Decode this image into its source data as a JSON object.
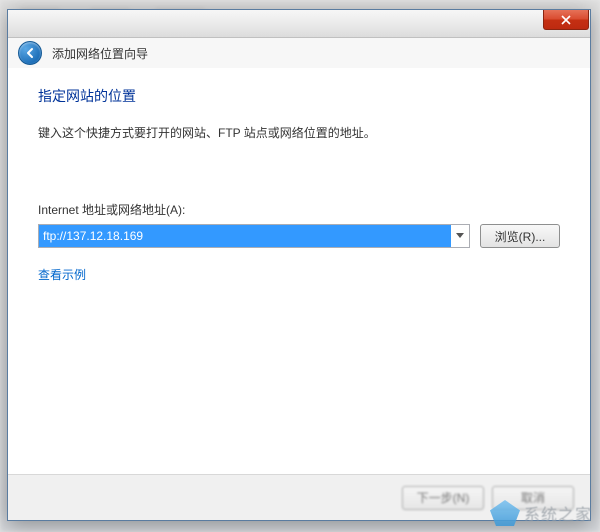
{
  "wizard": {
    "title": "添加网络位置向导"
  },
  "page": {
    "heading": "指定网站的位置",
    "description": "键入这个快捷方式要打开的网站、FTP 站点或网络位置的地址。"
  },
  "field": {
    "label": "Internet 地址或网络地址(A):",
    "value": "ftp://137.12.18.169",
    "browse": "浏览(R)..."
  },
  "links": {
    "example": "查看示例"
  },
  "footer": {
    "next": "下一步(N)",
    "cancel": "取消"
  },
  "watermark": {
    "text": "系统之家"
  }
}
